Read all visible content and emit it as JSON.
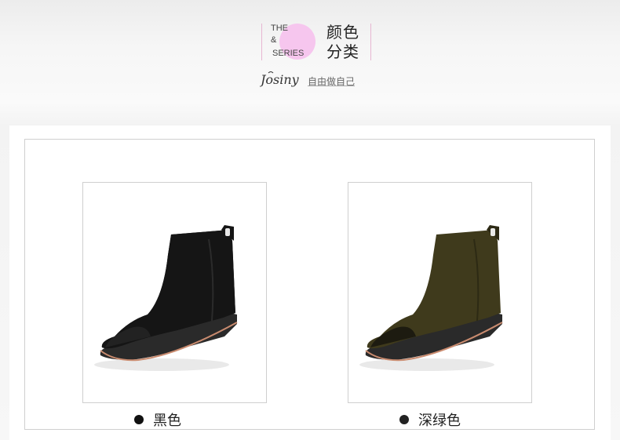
{
  "header": {
    "series_line1": "THE",
    "series_line2": "&",
    "series_line3": "SERIES",
    "title_line1": "颜色",
    "title_line2": "分类",
    "logo_text": "Josiny",
    "slogan": "自由做自己"
  },
  "colors": {
    "accent_pink": "#f6c6ee",
    "divider_pink": "#e7b6d2",
    "black_boot": "#151515",
    "dark_green_boot": "#3f3a1c"
  },
  "products": [
    {
      "label": "黑色",
      "boot_color": "#151515"
    },
    {
      "label": "深绿色",
      "boot_color": "#3f3a1c"
    }
  ]
}
